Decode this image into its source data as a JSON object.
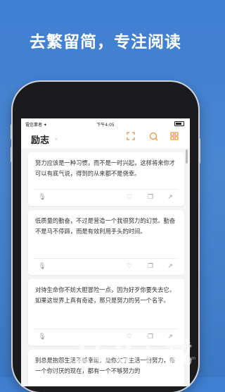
{
  "headline": "去繁留简，专注阅读",
  "status": {
    "carrier": "電信業者 ✦",
    "time": "下午4:05"
  },
  "nav": {
    "title": "励志",
    "caret_icon": "chevron-down-icon",
    "icons": [
      "fullscreen-icon",
      "search-icon",
      "grid-icon"
    ],
    "accent": "#e8913a"
  },
  "cards": [
    {
      "text": "努力应该是一种习惯，而不是一时兴起，这样将来你才可以有底气说，得到的从来都不是侥幸。"
    },
    {
      "text": "低质量的勤奋，不过是营造一个我很努力的幻觉。勤奋不是马不停蹄，而是有效利用手头的时间。"
    },
    {
      "text": "对待生命你不妨大胆冒险一点，因为好歹你要失去它。如果这世界上真有奇迹，那只是努力的另一个名字。"
    },
    {
      "text": "别总是抱怨生活不够幸运，是你欠了生活一份努力，每一个你讨厌的现在，都有一个不够努力的"
    }
  ],
  "card_actions": [
    "mic-icon",
    "heart-icon",
    "copy-icon",
    "share-icon"
  ],
  "watermark": "168下载",
  "watermark_sub": "www.168.com"
}
